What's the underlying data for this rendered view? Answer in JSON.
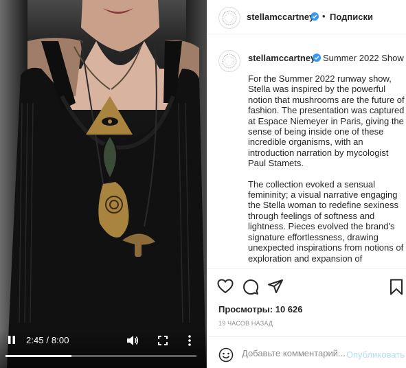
{
  "video": {
    "time_label": "2:45 / 8:00",
    "progress_fraction": 0.344
  },
  "header": {
    "username": "stellamccartney",
    "separator": "•",
    "follow_label": "Подписки"
  },
  "caption": {
    "username": "stellamccartney",
    "title": "Summer 2022 Show",
    "paragraphs": [
      "For the Summer 2022 runway show, Stella was inspired by the powerful notion that mushrooms are the future of fashion. The presentation was captured at Espace Niemeyer in Paris, giving the sense of being inside one of these incredible organisms, with an introduction narration by mycologist Paul Stamets.",
      "The collection evoked a sensual femininity; a visual narrative engaging the Stella woman to redefine sexiness through feelings of softness and lightness. Pieces evolved the brand's signature effortlessness, drawing unexpected inspirations from notions of exploration and expansion of"
    ]
  },
  "stats": {
    "views_label": "Просмотры:",
    "views_count": "10 626",
    "time_ago": "19 ЧАСОВ НАЗАД"
  },
  "comment": {
    "placeholder": "Добавьте комментарий...",
    "post_label": "Опубликовать"
  },
  "colors": {
    "verified": "#3897f0",
    "post_disabled": "#b2dffc",
    "muted_text": "#8e8e8e",
    "video_bg": "#0d0d0d"
  },
  "icons": {
    "play_pause": "pause-icon",
    "mute": "volume-icon",
    "fullscreen": "fullscreen-icon",
    "more": "more-vertical-icon",
    "like": "heart-icon",
    "comment": "comment-icon",
    "share": "share-icon",
    "save": "bookmark-icon",
    "emoji": "emoji-icon",
    "verified": "verified-badge-icon"
  }
}
